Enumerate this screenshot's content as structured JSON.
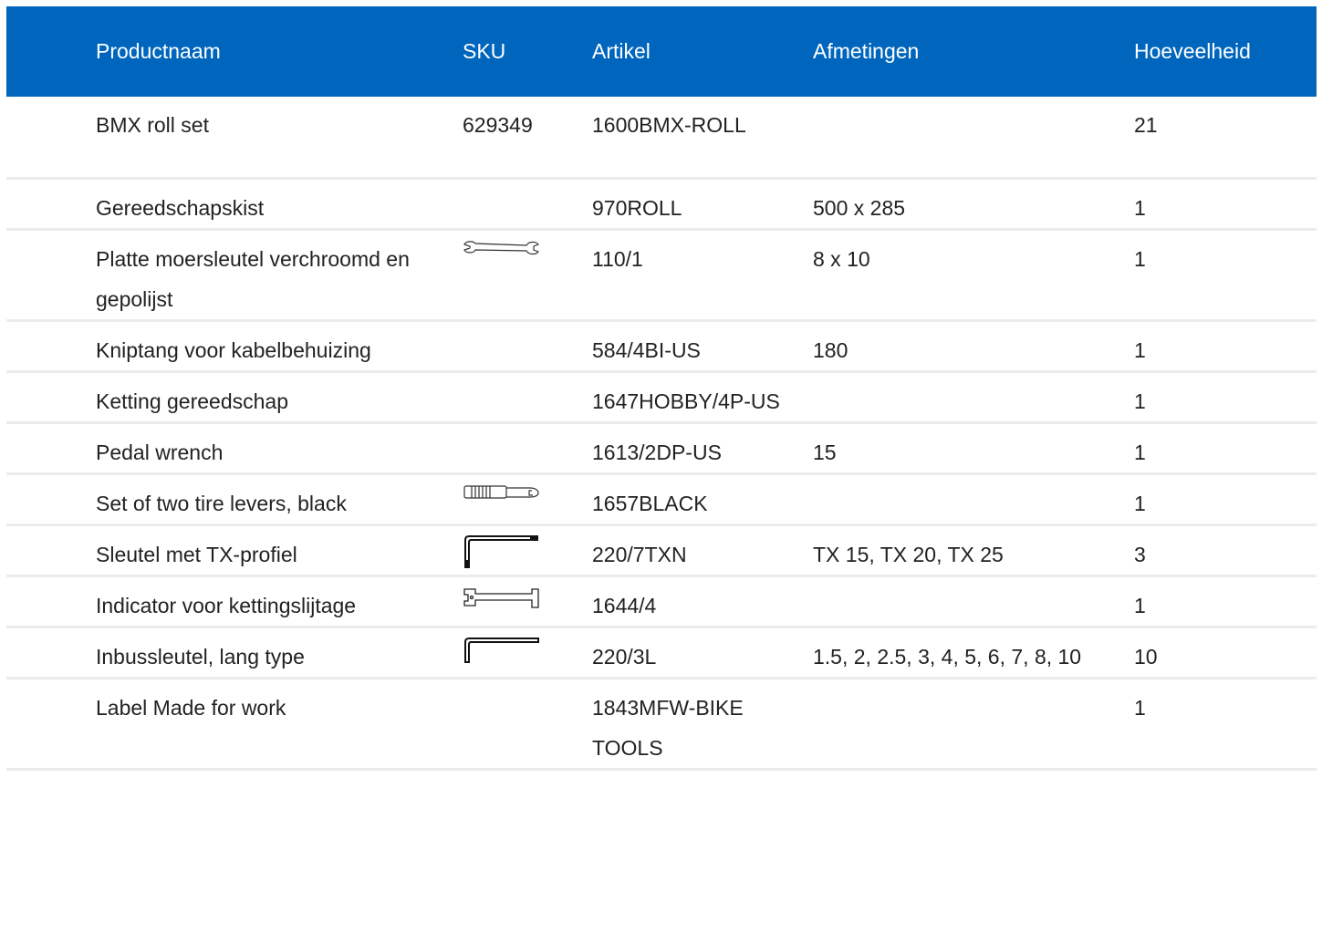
{
  "table": {
    "headers": [
      "Productnaam",
      "SKU",
      "Artikel",
      "Afmetingen",
      "Hoeveelheid"
    ],
    "rows": [
      {
        "name": "BMX roll set",
        "sku": "629349",
        "icon": "",
        "article": "1600BMX-ROLL",
        "dimensions": "",
        "quantity": "21"
      },
      {
        "name": "Gereedschapskist",
        "sku": "",
        "icon": "",
        "article": "970ROLL",
        "dimensions": "500 x 285",
        "quantity": "1"
      },
      {
        "name": "Platte moersleutel verchroomd en gepolijst",
        "sku": "",
        "icon": "open-end-wrench-icon",
        "article": "110/1",
        "dimensions": "8 x 10",
        "quantity": "1"
      },
      {
        "name": "Kniptang voor kabelbehuizing",
        "sku": "",
        "icon": "",
        "article": "584/4BI-US",
        "dimensions": "180",
        "quantity": "1"
      },
      {
        "name": "Ketting gereedschap",
        "sku": "",
        "icon": "",
        "article": "1647HOBBY/4P-US",
        "dimensions": "",
        "quantity": "1"
      },
      {
        "name": "Pedal wrench",
        "sku": "",
        "icon": "",
        "article": "1613/2DP-US",
        "dimensions": "15",
        "quantity": "1"
      },
      {
        "name": "Set of two tire levers, black",
        "sku": "",
        "icon": "tire-lever-icon",
        "article": "1657BLACK",
        "dimensions": "",
        "quantity": "1"
      },
      {
        "name": "Sleutel met TX-profiel",
        "sku": "",
        "icon": "torx-key-icon",
        "article": "220/7TXN",
        "dimensions": "TX 15, TX 20, TX 25",
        "quantity": "3"
      },
      {
        "name": "Indicator voor kettingslijtage",
        "sku": "",
        "icon": "chain-wear-indicator-icon",
        "article": "1644/4",
        "dimensions": "",
        "quantity": "1"
      },
      {
        "name": "Inbussleutel, lang type",
        "sku": "",
        "icon": "hex-key-icon",
        "article": "220/3L",
        "dimensions": "1.5, 2, 2.5, 3, 4, 5, 6, 7, 8, 10",
        "quantity": "10"
      },
      {
        "name": "Label Made for work",
        "sku": "",
        "icon": "",
        "article": "1843MFW-BIKE TOOLS",
        "dimensions": "",
        "quantity": "1"
      }
    ]
  },
  "colors": {
    "header_bg": "#0066bd",
    "header_text": "#ffffff",
    "row_divider": "#ececec"
  }
}
